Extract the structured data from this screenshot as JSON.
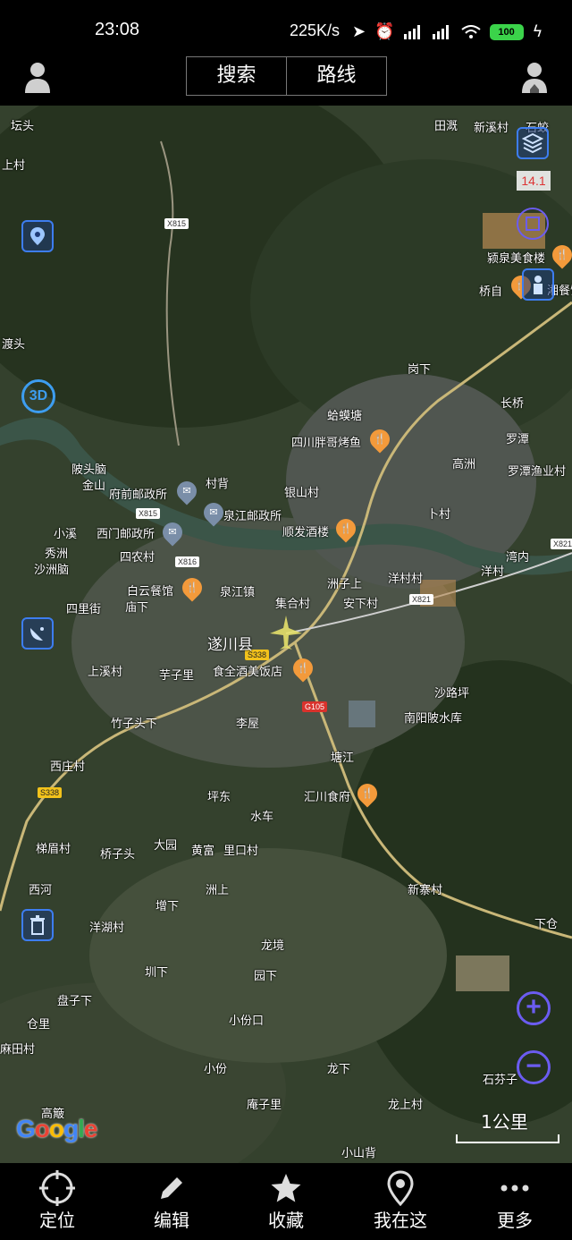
{
  "status_bar": {
    "time": "23:08",
    "network_speed": "225K/s",
    "battery": "100",
    "icons": [
      "location-arrow-icon",
      "alarm-icon",
      "signal-icon",
      "hd-signal-icon",
      "wifi-icon",
      "battery-icon",
      "charging-icon"
    ]
  },
  "top_bar": {
    "search_label": "搜索",
    "route_label": "路线"
  },
  "map": {
    "zoom_level": "14.1",
    "scale_label": "1公里",
    "logo": "Google",
    "county_label": "遂川县",
    "places": [
      "坛头",
      "上村",
      "X815",
      "田溉",
      "新溪村",
      "石蛟",
      "颍泉美食楼",
      "桥自",
      "湘餐馆",
      "渡头",
      "岗下",
      "长桥",
      "蛤蟆塘",
      "四川胖哥烤鱼",
      "罗潭",
      "高洲",
      "罗潭渔业村",
      "陂头脑",
      "金山",
      "府前邮政所",
      "村背",
      "银山村",
      "X815",
      "泉江邮政所",
      "卜村",
      "小溪",
      "西门邮政所",
      "顺发酒楼",
      "秀洲",
      "沙洲脑",
      "四农村",
      "X816",
      "湾内",
      "X821",
      "白云餐馆",
      "庙下",
      "泉江镇",
      "洲子上",
      "洋村村",
      "洋村",
      "集合村",
      "安下村",
      "X821",
      "四里街",
      "上溪村",
      "芋子里",
      "食全酒美饭店",
      "S338",
      "沙路坪",
      "竹子头下",
      "G105",
      "南阳陂水库",
      "李屋",
      "塘江",
      "西庄村",
      "S338",
      "坪东",
      "汇川食府",
      "水车",
      "梯眉村",
      "桥子头",
      "大园",
      "黄富",
      "里口村",
      "新寨村",
      "西河",
      "增下",
      "洲上",
      "洋湖村",
      "下仓",
      "龙境",
      "圳下",
      "园下",
      "盘子下",
      "小份口",
      "仓里",
      "麻田村",
      "小份",
      "龙下",
      "石芬子",
      "高簸",
      "庵子里",
      "龙上村",
      "小山背"
    ]
  },
  "bottom_nav": [
    {
      "label": "定位",
      "icon": "crosshair-icon"
    },
    {
      "label": "编辑",
      "icon": "pencil-icon"
    },
    {
      "label": "收藏",
      "icon": "star-icon"
    },
    {
      "label": "我在这",
      "icon": "location-pin-icon"
    },
    {
      "label": "更多",
      "icon": "more-dots-icon"
    }
  ],
  "colors": {
    "accent_blue": "#3d7df0",
    "zoom_purple": "#6b5cf0",
    "poi_food": "#f39a3b",
    "battery_green": "#3bd34a"
  }
}
